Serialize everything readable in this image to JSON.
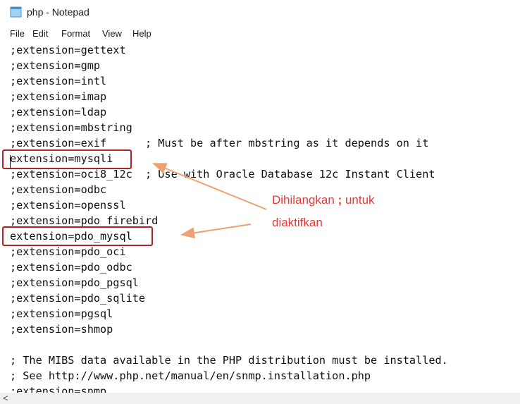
{
  "window": {
    "title": "php - Notepad"
  },
  "menu": [
    "File",
    "Edit",
    "Format",
    "View",
    "Help"
  ],
  "lines": [
    ";extension=gettext",
    ";extension=gmp",
    ";extension=intl",
    ";extension=imap",
    ";extension=ldap",
    ";extension=mbstring",
    ";extension=exif      ; Must be after mbstring as it depends on it",
    "extension=mysqli",
    ";extension=oci8_12c  ; Use with Oracle Database 12c Instant Client",
    ";extension=odbc",
    ";extension=openssl",
    ";extension=pdo_firebird",
    "extension=pdo_mysql",
    ";extension=pdo_oci",
    ";extension=pdo_odbc",
    ";extension=pdo_pgsql",
    ";extension=pdo_sqlite",
    ";extension=pgsql",
    ";extension=shmop",
    "",
    "; The MIBS data available in the PHP distribution must be installed.",
    "; See http://www.php.net/manual/en/snmp.installation.php",
    ";extension=snmp"
  ],
  "annotation": {
    "line1_pre": "Dihilangkan ",
    "line1_bold": ";",
    "line1_post": " untuk",
    "line2": "diaktifkan"
  },
  "colors": {
    "highlight": "#b22222",
    "annotation": "#e53935",
    "arrow": "#f0a070"
  },
  "scrollbar": {
    "left_arrow": "<"
  }
}
